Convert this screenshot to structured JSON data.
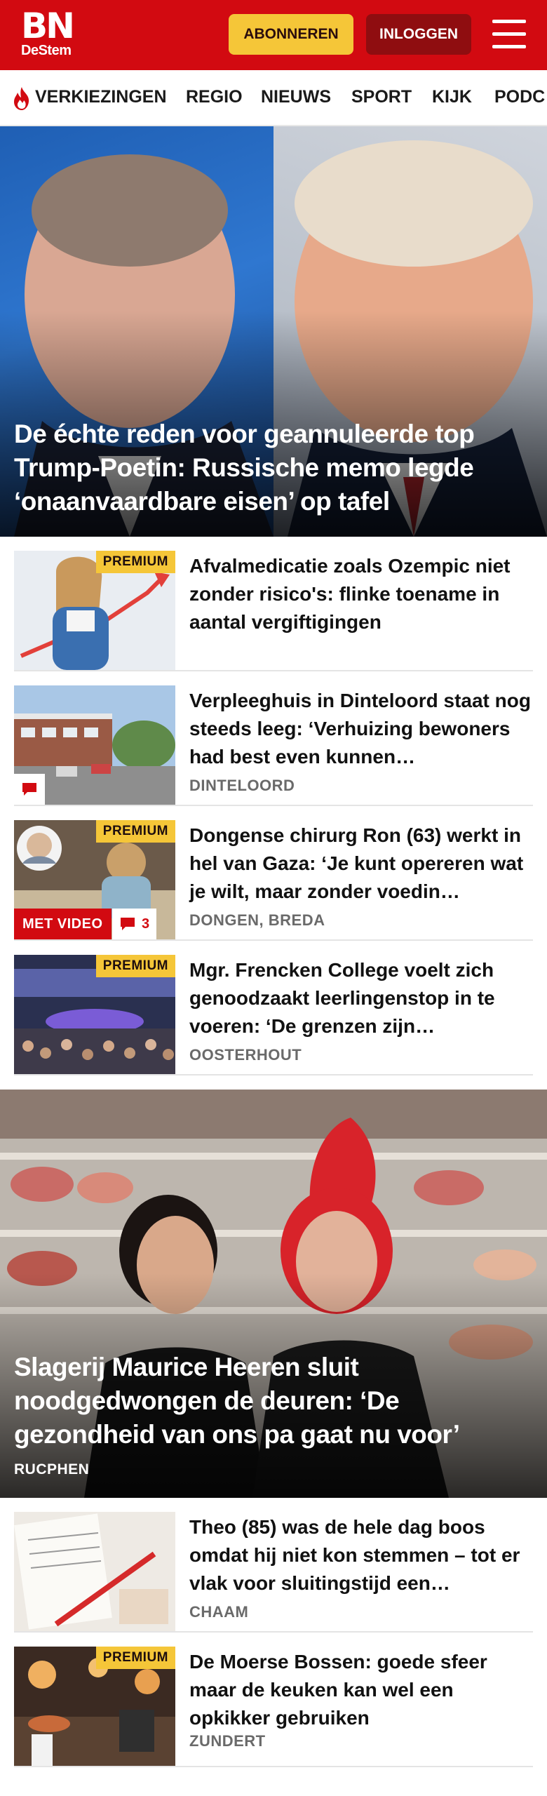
{
  "header": {
    "logo_top": "BN",
    "logo_bottom": "DeStem",
    "subscribe_label": "ABONNEREN",
    "login_label": "INLOGGEN"
  },
  "nav": {
    "items": [
      "VERKIEZINGEN",
      "REGIO",
      "NIEUWS",
      "SPORT",
      "KIJK",
      "PODC"
    ]
  },
  "colors": {
    "brand_red": "#d20a11",
    "premium_yellow": "#f5c638",
    "dark_red": "#8f0d10"
  },
  "lead": {
    "title": "De échte reden voor geannuleerde top Trump-Poetin: Russische memo legde ‘onaanvaardbare eisen’ op tafel"
  },
  "articles": [
    {
      "title": "Afvalmedicatie zoals Ozempic niet zonder risico's: flinke toename in aantal vergiftigingen",
      "location": "",
      "premium": "PREMIUM"
    },
    {
      "title": "Verpleeghuis in Dinteloord staat nog steeds leeg: ‘Verhuizing bewoners had best even kunnen…",
      "location": "DINTELOORD"
    },
    {
      "title": "Dongense chirurg Ron (63) werkt in hel van Gaza: ‘Je kunt opereren wat je wilt, maar zonder voedin…",
      "location": "DONGEN, BREDA",
      "premium": "PREMIUM",
      "video": "MET VIDEO",
      "comments": "3"
    },
    {
      "title": "Mgr. Frencken College voelt zich genoodzaakt leerlingenstop in te voeren: ‘De grenzen zijn…",
      "location": "OOSTERHOUT",
      "premium": "PREMIUM"
    }
  ],
  "feature": {
    "title": "Slagerij Maurice Heeren sluit noodgedwongen de deuren: ‘De gezondheid van ons pa gaat nu voor’",
    "location": "RUCPHEN"
  },
  "articles2": [
    {
      "title": "Theo (85) was de hele dag boos omdat hij niet kon stemmen – tot er vlak voor sluitingstijd een…",
      "location": "CHAAM"
    },
    {
      "title": "De Moerse Bossen: goede sfeer maar de keuken kan wel een opkikker gebruiken",
      "location": "ZUNDERT",
      "premium": "PREMIUM"
    }
  ]
}
